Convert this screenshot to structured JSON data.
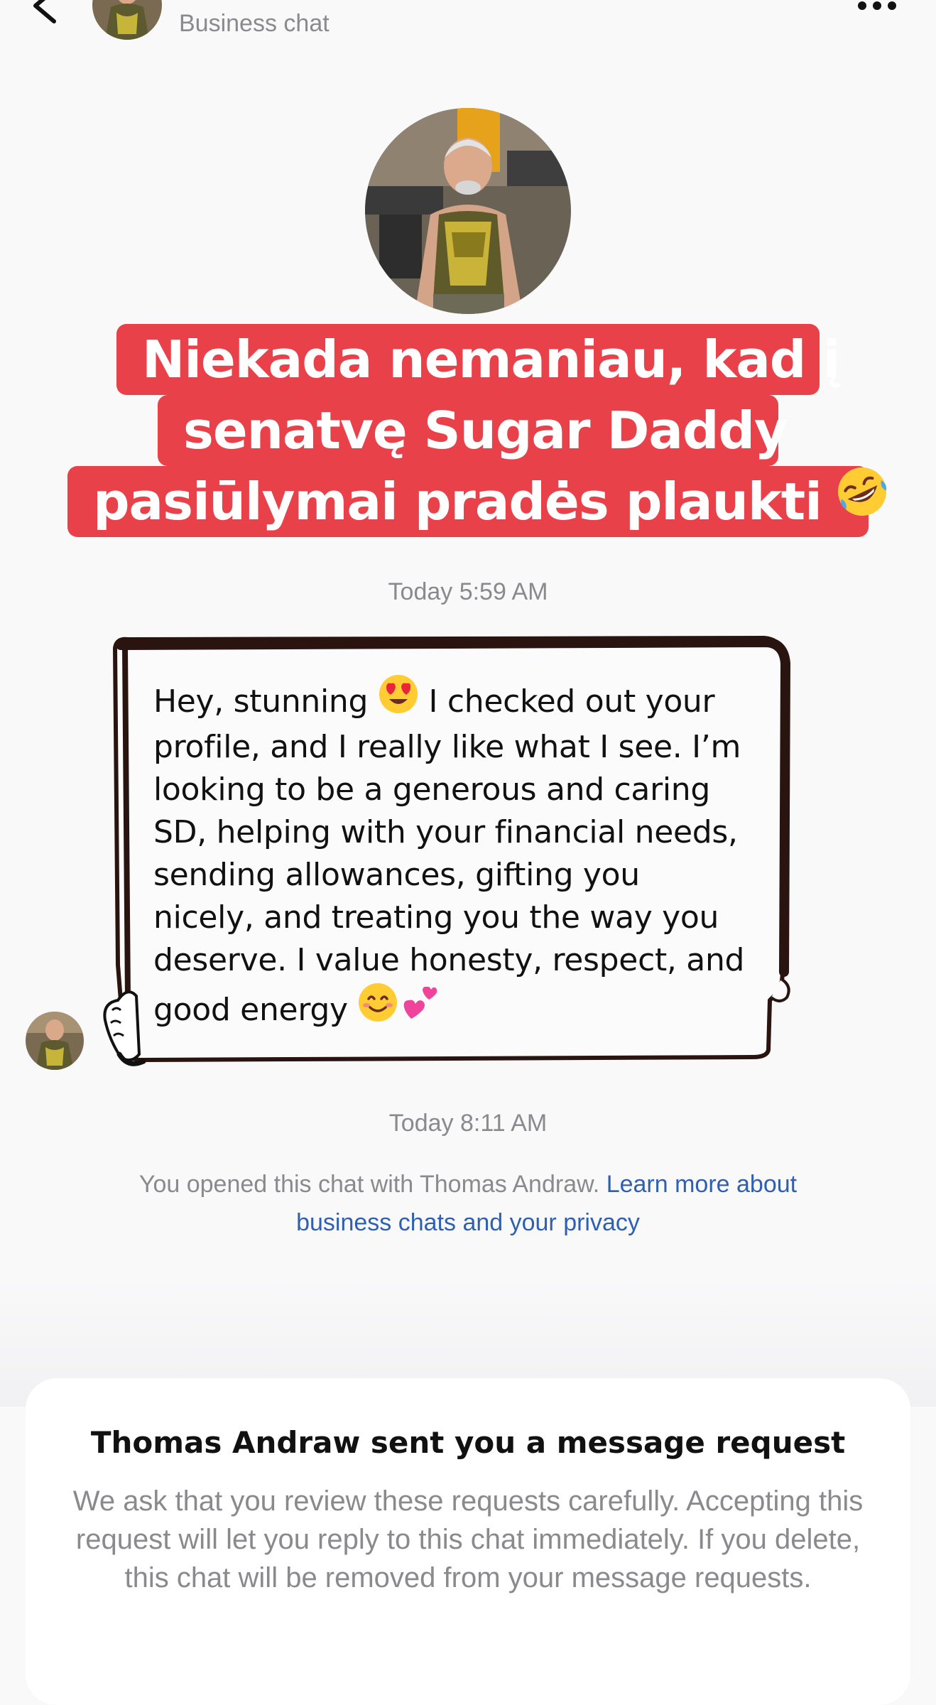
{
  "header": {
    "subtitle": "Business chat",
    "back_icon": "chevron-left-icon",
    "more_icon": "ellipsis-icon"
  },
  "caption": {
    "lines": [
      "Niekada nemaniau, kad į",
      "senatvę Sugar Daddy",
      "pasiūlymai pradės plaukti"
    ],
    "emoji": "rolling-on-floor-laughing-emoji",
    "background_color": "#e8414a"
  },
  "timestamps": {
    "first": "Today 5:59 AM",
    "second": "Today 8:11 AM"
  },
  "message": {
    "lines": [
      "Hey, stunning",
      "I checked out your",
      "profile, and I really like what I see. I’m",
      "looking to be a generous and caring",
      "SD, helping with your financial needs,",
      "sending allowances, gifting you",
      "nicely, and treating you the way you",
      "deserve. I value honesty, respect, and",
      "good energy"
    ],
    "emojis": [
      "heart-eyes-emoji",
      "smiling-face-emoji",
      "two-hearts-emoji"
    ]
  },
  "info": {
    "text": "You opened this chat with Thomas Andraw.",
    "link": "Learn more about business chats and your privacy",
    "link_color": "#2f5fb3"
  },
  "request": {
    "title": "Thomas Andraw sent you a message request",
    "body": "We ask that you review these requests carefully. Accepting this request will let you reply to this chat immediately. If you delete, this chat will be removed from your message requests."
  }
}
